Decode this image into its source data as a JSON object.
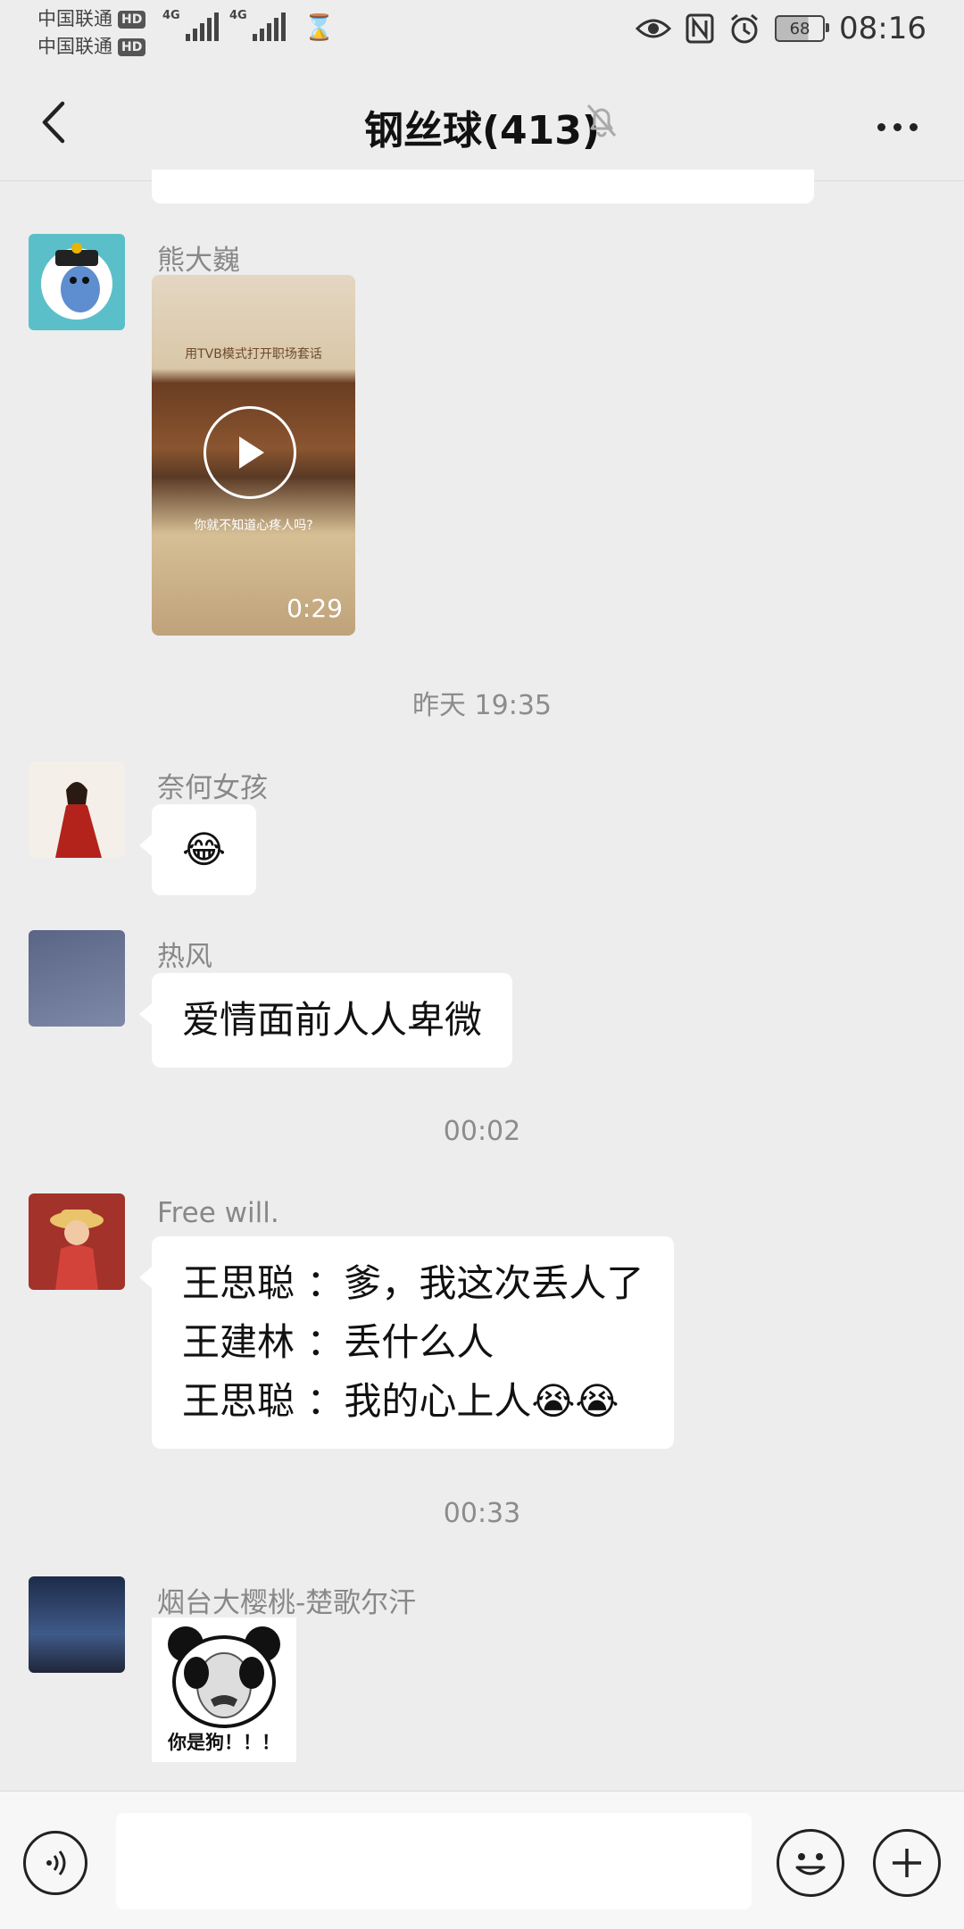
{
  "status_bar": {
    "carrier_1": "中国联通",
    "carrier_2": "中国联通",
    "hd_label": "HD",
    "network_type": "4G",
    "battery_level": "68",
    "time": "08:16"
  },
  "header": {
    "title": "钢丝球(413)",
    "muted": true
  },
  "messages": [
    {
      "sender": "熊大巍",
      "type": "video",
      "video_banner": "用TVB模式打开职场套话",
      "video_caption": "你就不知道心疼人吗?",
      "duration": "0:29"
    },
    {
      "timestamp": "昨天 19:35"
    },
    {
      "sender": "奈何女孩",
      "type": "emoji",
      "content": "😂"
    },
    {
      "sender": "热风",
      "type": "text",
      "content": "爱情面前人人卑微"
    },
    {
      "timestamp": "00:02"
    },
    {
      "sender": "Free will.",
      "type": "text",
      "lines": [
        "王思聪 ：爹，我这次丢人了",
        "王建林 ：丢什么人",
        "王思聪 ：我的心上人😭😭"
      ]
    },
    {
      "timestamp": "00:33"
    },
    {
      "sender": "烟台大樱桃-楚歌尔汗",
      "type": "sticker",
      "sticker_caption": "你是狗！！！"
    }
  ],
  "input_bar": {
    "placeholder": "",
    "icons": [
      "voice-icon",
      "emoji-icon",
      "plus-icon"
    ]
  },
  "colors": {
    "background": "#ededed",
    "bubble": "#ffffff",
    "meta_text": "#888888"
  }
}
